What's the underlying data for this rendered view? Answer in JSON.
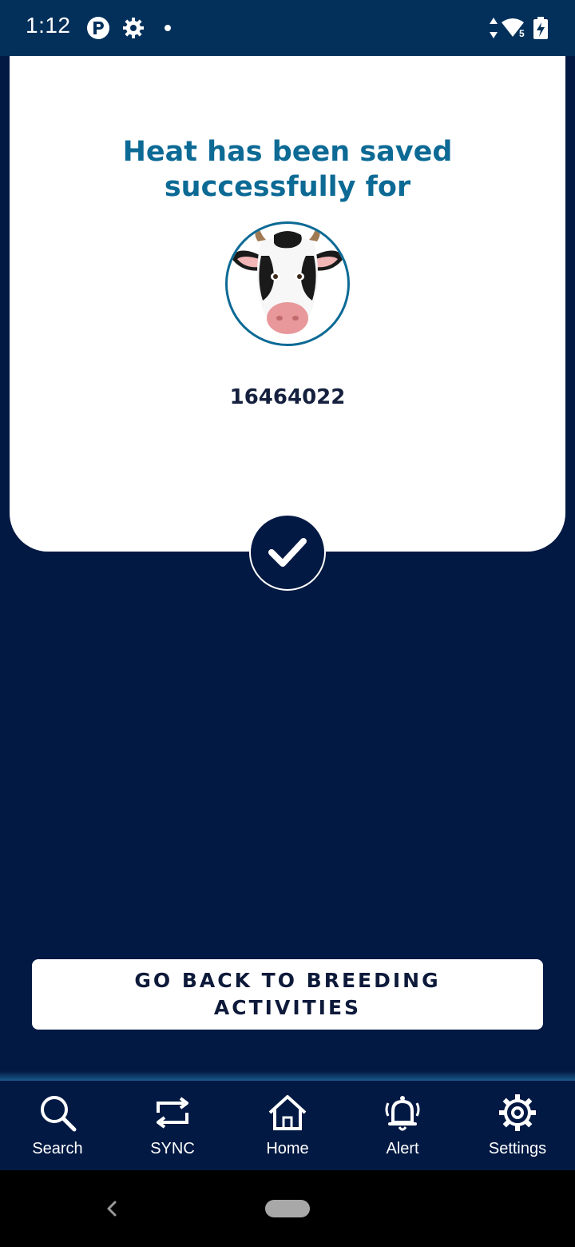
{
  "status_bar": {
    "time": "1:12",
    "icons": [
      "app-p-icon",
      "gear-icon",
      "dot-icon",
      "data-arrows-icon",
      "wifi-icon",
      "battery-charging-icon"
    ]
  },
  "card": {
    "title": "Heat has been saved\nsuccessfully for",
    "animal_id": "16464022",
    "avatar_icon": "cow-face-icon",
    "badge_icon": "checkmark-icon"
  },
  "primary_button": {
    "label": "GO BACK TO BREEDING\nACTIVITIES"
  },
  "bottom_nav": {
    "items": [
      {
        "label": "Search",
        "icon": "search-icon"
      },
      {
        "label": "SYNC",
        "icon": "sync-icon"
      },
      {
        "label": "Home",
        "icon": "home-icon"
      },
      {
        "label": "Alert",
        "icon": "bell-icon"
      },
      {
        "label": "Settings",
        "icon": "gear-icon"
      }
    ]
  },
  "colors": {
    "background": "#021943",
    "status_bar": "#02305b",
    "title": "#0c6a95",
    "card": "#ffffff"
  }
}
